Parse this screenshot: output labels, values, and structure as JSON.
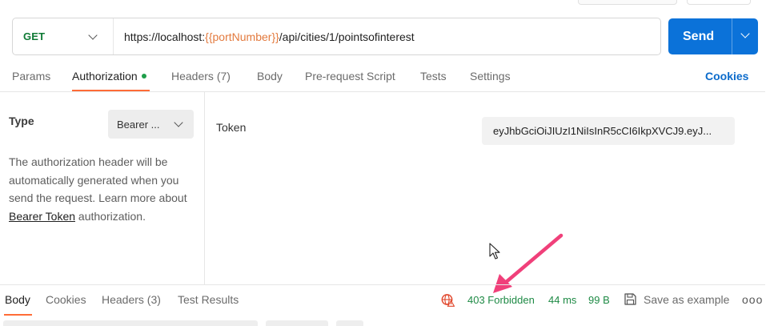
{
  "request": {
    "method": "GET",
    "url_prefix": "https://localhost:",
    "url_variable": "{{portNumber}}",
    "url_suffix": "/api/cities/1/pointsofinterest",
    "send_label": "Send"
  },
  "request_tabs": {
    "params": "Params",
    "authorization": "Authorization",
    "headers": "Headers",
    "headers_count": "(7)",
    "body": "Body",
    "prerequest": "Pre-request Script",
    "tests": "Tests",
    "settings": "Settings",
    "cookies": "Cookies"
  },
  "auth": {
    "type_label": "Type",
    "type_value": "Bearer ...",
    "description_line1": "The authorization header will be",
    "description_line2": "automatically generated when you",
    "description_line3": "send the request. Learn more about",
    "link_text": "Bearer Token",
    "description_tail": " authorization.",
    "token_label": "Token",
    "token_value": "eyJhbGciOiJIUzI1NiIsInR5cCI6IkpXVCJ9.eyJ..."
  },
  "response": {
    "tabs": {
      "body": "Body",
      "cookies": "Cookies",
      "headers": "Headers (3)",
      "test_results": "Test Results"
    },
    "status": "403 Forbidden",
    "time": "44 ms",
    "size": "99 B",
    "save_label": "Save as example",
    "more": "ooo"
  },
  "colors": {
    "accent": "#ff6c37",
    "send_button": "#0b72d9",
    "method_get": "#0f7a35",
    "variable": "#e37a3e",
    "status_text": "#1e8a45",
    "annotation_arrow": "#f0407a",
    "link": "#0b6bcb"
  },
  "icons": [
    "chevron-down-icon",
    "globe-warning-icon",
    "save-icon",
    "more-icon",
    "mouse-cursor-icon",
    "annotation-arrow"
  ]
}
